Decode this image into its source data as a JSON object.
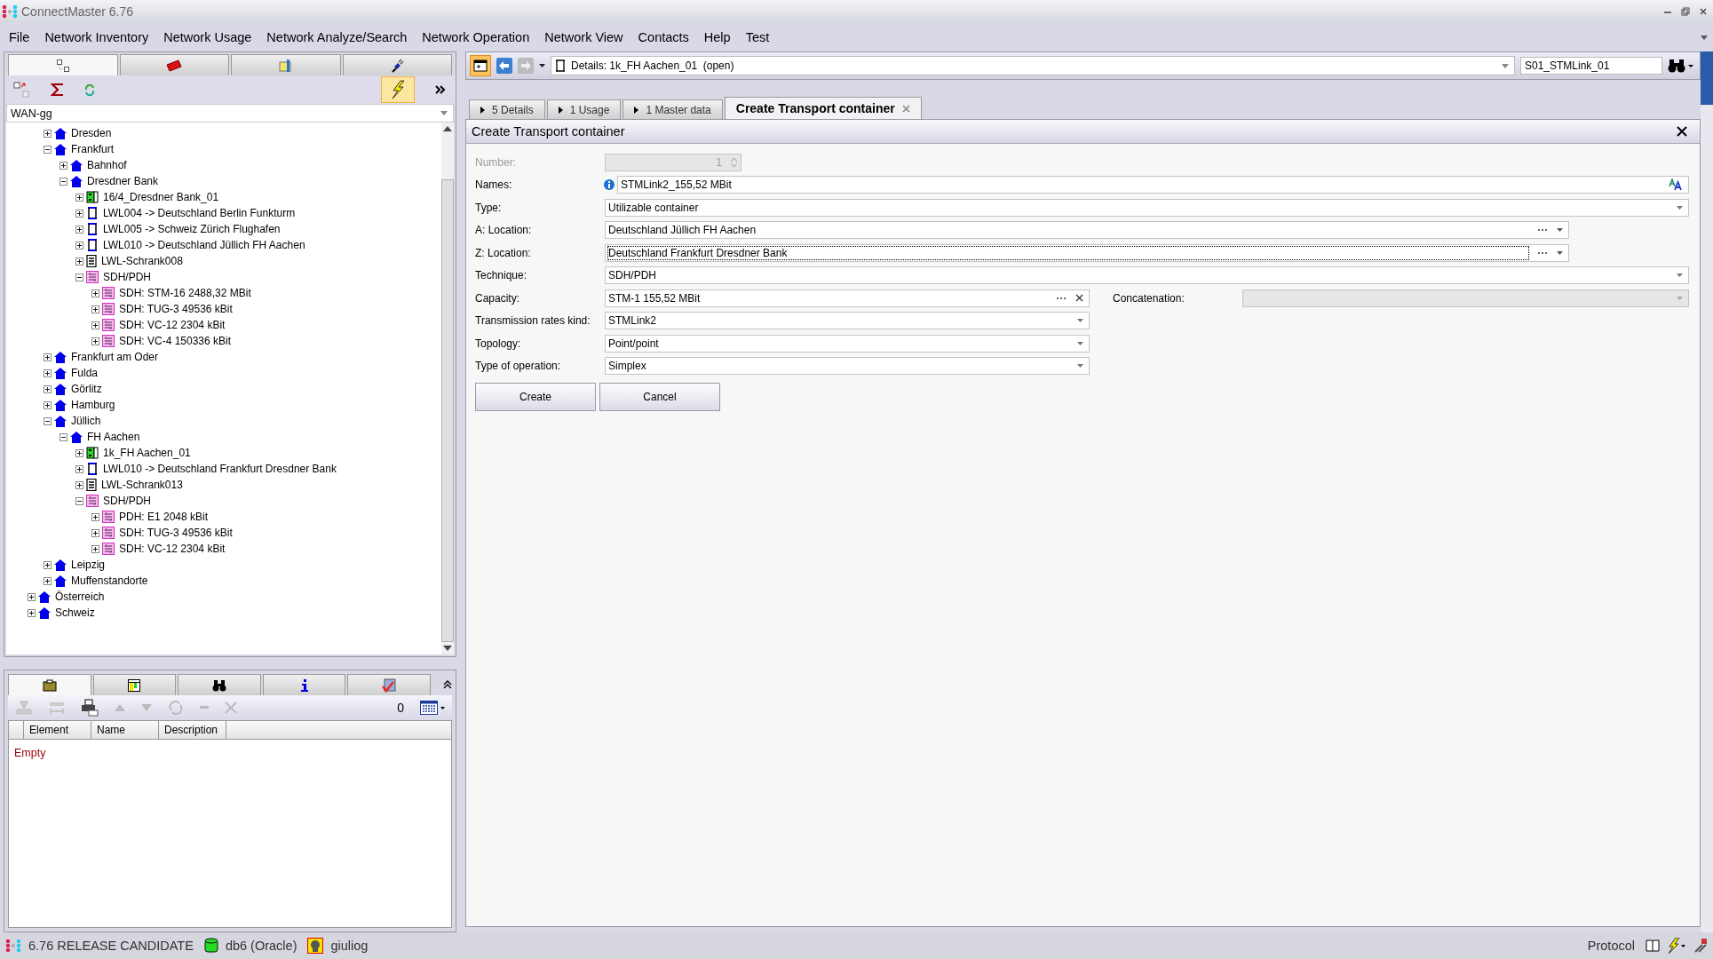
{
  "window": {
    "title": "ConnectMaster 6.76"
  },
  "menu": [
    "File",
    "Network Inventory",
    "Network Usage",
    "Network Analyze/Search",
    "Network Operation",
    "Network View",
    "Contacts",
    "Help",
    "Test"
  ],
  "left_tabs": [
    {
      "kind": "tree",
      "selected": true
    },
    {
      "kind": "toolbox",
      "selected": false
    },
    {
      "kind": "folder",
      "selected": false
    },
    {
      "kind": "plug",
      "selected": false
    }
  ],
  "tree_toolbar": {
    "flash_on": true
  },
  "tree_filter": {
    "value": "WAN-gg"
  },
  "tree": {
    "continued_children": [
      {
        "label": "Dresden",
        "kind": "location",
        "expanded": false
      },
      {
        "label": "Frankfurt",
        "kind": "location",
        "expanded": true,
        "children": [
          {
            "label": "Bahnhof",
            "kind": "location",
            "expanded": false
          },
          {
            "label": "Dresdner Bank",
            "kind": "location",
            "expanded": true,
            "children": [
              {
                "label": "16/4_Dresdner Bank_01",
                "kind": "rack",
                "expanded": false
              },
              {
                "label": "LWL004 -> Deutschland Berlin Funkturm",
                "kind": "cable",
                "expanded": false
              },
              {
                "label": "LWL005 -> Schweiz Zürich Flughafen",
                "kind": "cable",
                "expanded": false
              },
              {
                "label": "LWL010 -> Deutschland Jüllich FH Aachen",
                "kind": "cable",
                "expanded": false
              },
              {
                "label": "LWL-Schrank008",
                "kind": "cabinet",
                "expanded": false
              },
              {
                "label": "SDH/PDH",
                "kind": "sdh",
                "expanded": true,
                "children": [
                  {
                    "label": "SDH: STM-16 2488,32 MBit",
                    "kind": "sdh",
                    "expanded": false
                  },
                  {
                    "label": "SDH: TUG-3 49536 kBit",
                    "kind": "sdh",
                    "expanded": false
                  },
                  {
                    "label": "SDH: VC-12 2304 kBit",
                    "kind": "sdh",
                    "expanded": false
                  },
                  {
                    "label": "SDH: VC-4 150336 kBit",
                    "kind": "sdh",
                    "expanded": false
                  }
                ]
              }
            ]
          }
        ]
      },
      {
        "label": "Frankfurt am Oder",
        "kind": "location",
        "expanded": false
      },
      {
        "label": "Fulda",
        "kind": "location",
        "expanded": false
      },
      {
        "label": "Görlitz",
        "kind": "location",
        "expanded": false
      },
      {
        "label": "Hamburg",
        "kind": "location",
        "expanded": false
      },
      {
        "label": "Jüllich",
        "kind": "location",
        "expanded": true,
        "children": [
          {
            "label": "FH Aachen",
            "kind": "location",
            "expanded": true,
            "children": [
              {
                "label": "1k_FH Aachen_01",
                "kind": "rack",
                "expanded": false
              },
              {
                "label": "LWL010 -> Deutschland Frankfurt Dresdner Bank",
                "kind": "cable",
                "expanded": false
              },
              {
                "label": "LWL-Schrank013",
                "kind": "cabinet",
                "expanded": false
              },
              {
                "label": "SDH/PDH",
                "kind": "sdh",
                "expanded": true,
                "children": [
                  {
                    "label": "PDH: E1 2048 kBit",
                    "kind": "sdh",
                    "expanded": false
                  },
                  {
                    "label": "SDH: TUG-3 49536 kBit",
                    "kind": "sdh",
                    "expanded": false
                  },
                  {
                    "label": "SDH: VC-12 2304 kBit",
                    "kind": "sdh",
                    "expanded": false
                  }
                ]
              }
            ]
          }
        ]
      },
      {
        "label": "Leipzig",
        "kind": "location",
        "expanded": false
      },
      {
        "label": "Muffenstandorte",
        "kind": "location",
        "expanded": false
      }
    ],
    "items": [
      {
        "label": "Österreich",
        "kind": "location",
        "expanded": false
      },
      {
        "label": "Schweiz",
        "kind": "location",
        "expanded": false
      }
    ]
  },
  "bottom_tabs": [
    {
      "kind": "clipboard",
      "selected": true
    },
    {
      "kind": "table",
      "selected": false
    },
    {
      "kind": "binoculars",
      "selected": false
    },
    {
      "kind": "info",
      "selected": false
    },
    {
      "kind": "check",
      "selected": false
    }
  ],
  "bottom_toolbar": {
    "count": "0"
  },
  "bottom_table": {
    "columns": [
      "Element",
      "Name",
      "Description"
    ],
    "empty_text": "Empty"
  },
  "status_bar": {
    "version": "6.76 RELEASE CANDIDATE",
    "database": "db6 (Oracle)",
    "user": "giuliog",
    "protocol": "Protocol"
  },
  "details_toolbar": {
    "object": "Details: 1k_FH Aachen_01  (open)",
    "search": "S01_STMLink_01"
  },
  "detail_tabs": [
    {
      "label": "5 Details",
      "selected": false,
      "closable": false
    },
    {
      "label": "1 Usage",
      "selected": false,
      "closable": false
    },
    {
      "label": "1 Master data",
      "selected": false,
      "closable": false
    },
    {
      "label": "Create Transport container",
      "selected": true,
      "closable": true
    }
  ],
  "form": {
    "title": "Create Transport container",
    "fields": [
      {
        "label": "Number:",
        "kind": "number",
        "value": "1",
        "disabled": true
      },
      {
        "label": "Names:",
        "kind": "name",
        "value": "STMLink2_155,52 MBit",
        "disabled": false
      },
      {
        "label": "Type:",
        "kind": "select",
        "value": "Utilizable container",
        "disabled": false
      },
      {
        "label": "A: Location:",
        "kind": "location",
        "value": "Deutschland Jüllich FH Aachen",
        "disabled": false
      },
      {
        "label": "Z: Location:",
        "kind": "location",
        "value": "Deutschland Frankfurt Dresdner Bank",
        "disabled": false
      },
      {
        "label": "Technique:",
        "kind": "select",
        "value": "SDH/PDH",
        "disabled": false
      },
      {
        "label": "Capacity:",
        "kind": "capacity",
        "value": "STM-1 155,52 MBit",
        "disabled": false,
        "side_label": "Concatenation:"
      },
      {
        "label": "Transmission rates kind:",
        "kind": "option",
        "value": "STMLink2",
        "disabled": false
      },
      {
        "label": "Topology:",
        "kind": "option",
        "value": "Point/point",
        "disabled": false
      },
      {
        "label": "Type of operation:",
        "kind": "option",
        "value": "Simplex",
        "disabled": false
      }
    ],
    "buttons": [
      "Create",
      "Cancel"
    ]
  }
}
